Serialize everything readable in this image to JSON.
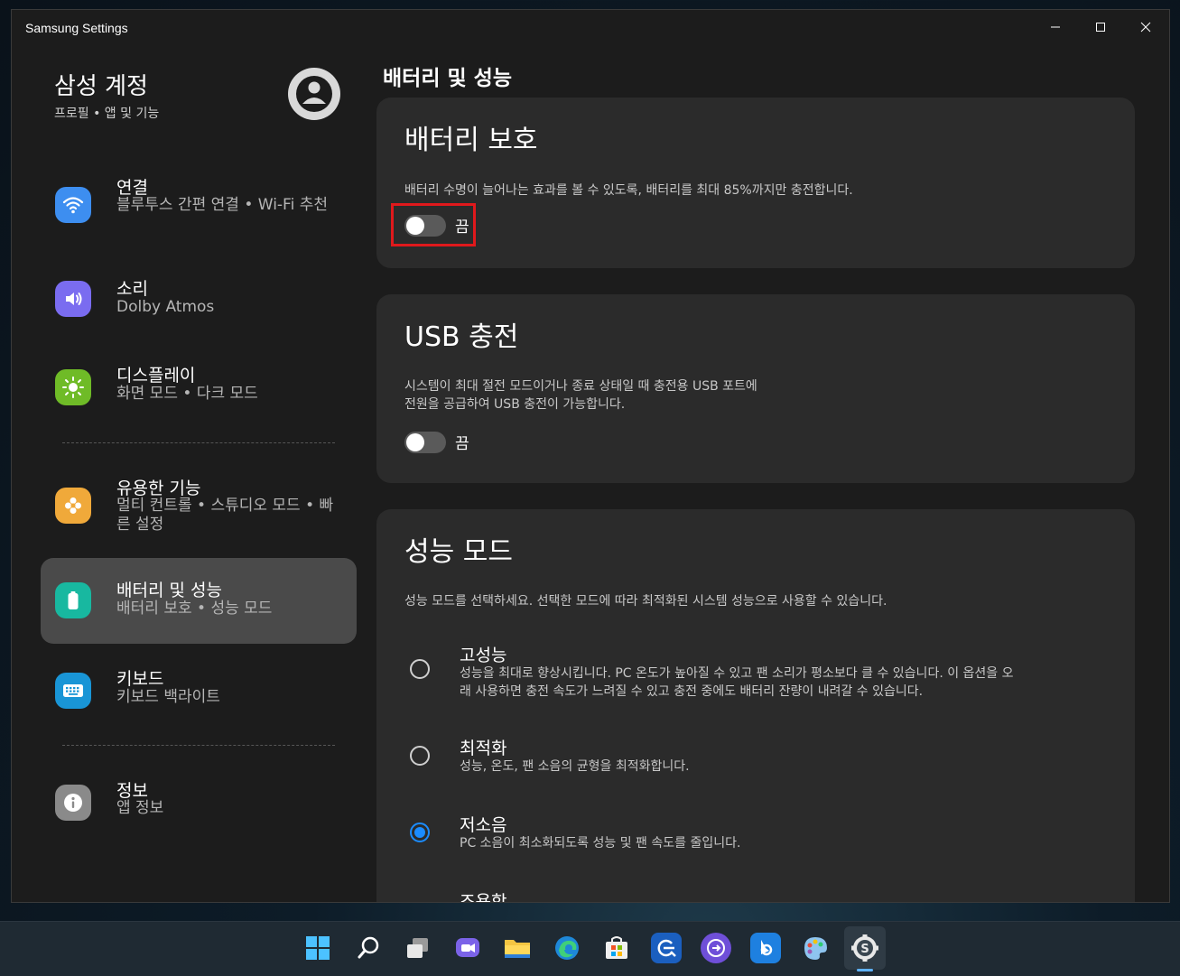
{
  "window": {
    "title": "Samsung Settings"
  },
  "account": {
    "title": "삼성 계정",
    "subtitle": "프로필 • 앱 및 기능"
  },
  "sidebar": {
    "items": [
      {
        "label": "연결",
        "sub": "블루투스 간편 연결  •  Wi-Fi 추천",
        "icon": "wifi-icon",
        "color": "#3d8ef0"
      },
      {
        "label": "소리",
        "sub": "Dolby Atmos",
        "icon": "speaker-icon",
        "color": "#7a6cf0"
      },
      {
        "label": "디스플레이",
        "sub": "화면 모드  •  다크 모드",
        "icon": "sun-icon",
        "color": "#6fbb27"
      },
      {
        "label": "유용한 기능",
        "sub": "멀티 컨트롤  •  스튜디오 모드  •  빠른 설정",
        "icon": "puzzle-icon",
        "color": "#f0a93a"
      },
      {
        "label": "배터리 및 성능",
        "sub": "배터리 보호  •  성능 모드",
        "icon": "battery-icon",
        "color": "#18b8a0"
      },
      {
        "label": "키보드",
        "sub": "키보드 백라이트",
        "icon": "keyboard-icon",
        "color": "#1995d6"
      },
      {
        "label": "정보",
        "sub": "앱 정보",
        "icon": "info-icon",
        "color": "#8a8a8a"
      }
    ]
  },
  "main": {
    "title": "배터리 및 성능",
    "battery_protect": {
      "title": "배터리 보호",
      "desc": "배터리 수명이 늘어나는 효과를 볼 수 있도록, 배터리를 최대 85%까지만 충전합니다.",
      "state": "끔"
    },
    "usb_charge": {
      "title": "USB 충전",
      "desc_line1": "시스템이 최대 절전 모드이거나 종료 상태일 때 충전용 USB 포트에",
      "desc_line2": "전원을 공급하여 USB 충전이 가능합니다.",
      "state": "끔"
    },
    "perf_mode": {
      "title": "성능 모드",
      "desc": "성능 모드를 선택하세요. 선택한 모드에 따라 최적화된 시스템 성능으로 사용할 수 있습니다.",
      "options": [
        {
          "label": "고성능",
          "desc_line1": "성능을 최대로 향상시킵니다. PC 온도가 높아질 수 있고 팬 소리가 평소보다 클 수 있습니다. 이 옵션을 오",
          "desc_line2": "래 사용하면 충전 속도가 느려질 수 있고 충전 중에도 배터리 잔량이 내려갈 수 있습니다."
        },
        {
          "label": "최적화",
          "desc_line1": "성능, 온도, 팬 소음의 균형을 최적화합니다.",
          "desc_line2": ""
        },
        {
          "label": "저소음",
          "desc_line1": "PC 소음이 최소화되도록 성능 및 팬 속도를 줄입니다.",
          "desc_line2": ""
        },
        {
          "label": "조용함",
          "desc_line1": "",
          "desc_line2": ""
        }
      ],
      "selected": "저소음"
    }
  },
  "taskbar": {
    "icons": [
      "windows-start-icon",
      "search-icon",
      "task-view-icon",
      "chat-icon",
      "file-explorer-icon",
      "edge-icon",
      "store-icon",
      "quick-search-icon",
      "samsung-link-icon",
      "bing-icon",
      "paint-icon",
      "samsung-settings-icon"
    ]
  }
}
